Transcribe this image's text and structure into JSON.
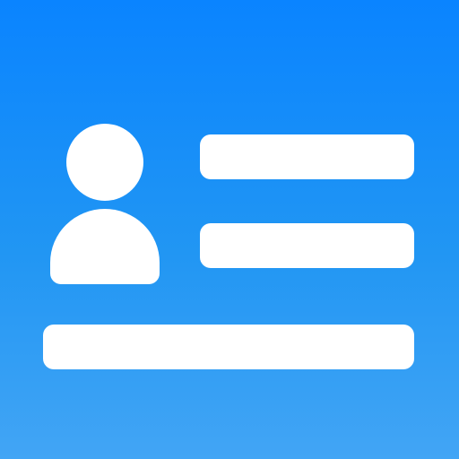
{
  "icon": {
    "name": "contact-card-icon",
    "background_gradient": [
      "#0a84ff",
      "#2196f3",
      "#42a5f5"
    ],
    "foreground_color": "#ffffff",
    "parts": [
      "avatar-icon",
      "text-line",
      "text-line",
      "text-line"
    ]
  }
}
